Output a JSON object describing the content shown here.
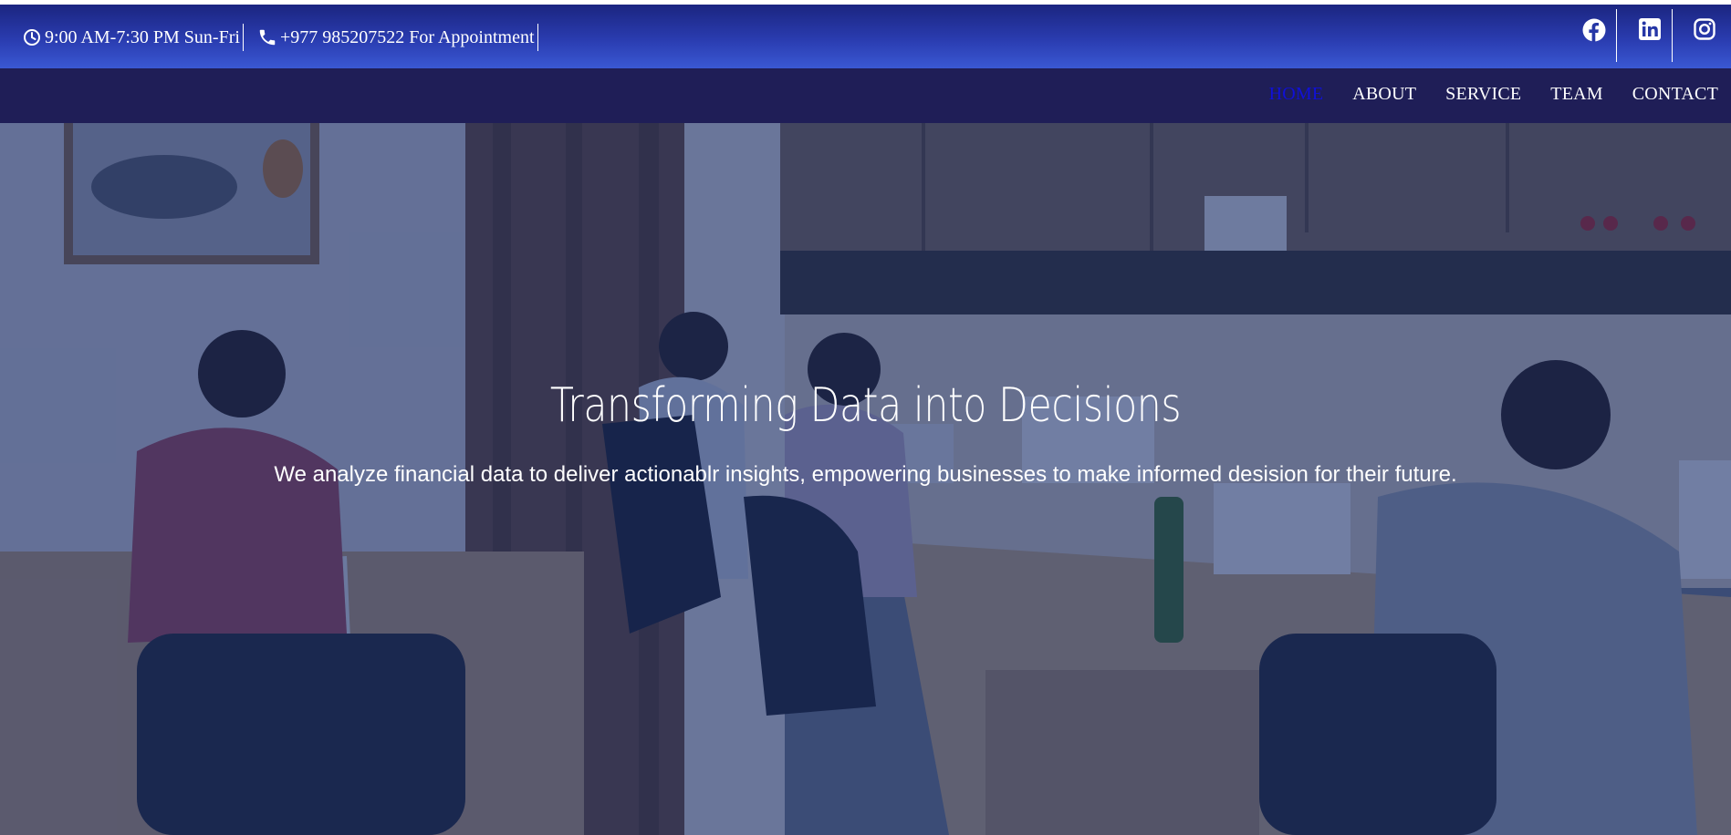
{
  "topbar": {
    "hours": "9:00 AM-7:30 PM Sun-Fri",
    "phone": "+977 985207522 For Appointment",
    "hours_icon": "clock-icon",
    "phone_icon": "phone-icon",
    "social": [
      "facebook-icon",
      "linkedin-icon",
      "instagram-icon"
    ]
  },
  "nav": {
    "items": [
      "HOME",
      "ABOUT",
      "SERVICE",
      "TEAM",
      "CONTACT"
    ],
    "active": "HOME"
  },
  "hero": {
    "title": "Transforming Data into Decisions",
    "subtitle": "We analyze financial data to deliver actionablr insights, empowering businesses to make informed desision for their future."
  },
  "colors": {
    "topbar_top": "#1b2580",
    "topbar_bottom": "#3a58d3",
    "navbar": "#1f1e57",
    "active_nav": "#1010d8",
    "overlay": "#102666"
  }
}
